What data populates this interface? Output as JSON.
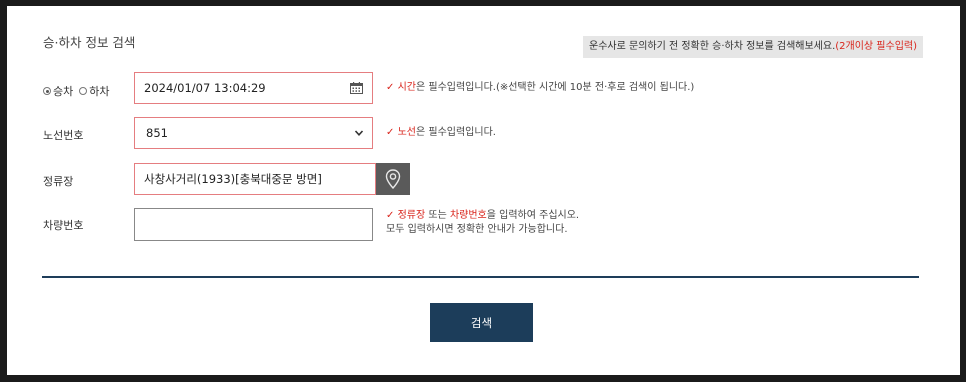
{
  "section": {
    "title": "승·하차 정보 검색",
    "notice_text": "운수사로 문의하기 전 정확한 승·하차 정보를 검색해보세요.",
    "notice_required": "(2개이상 필수입력)"
  },
  "time_row": {
    "radio_board": "승차",
    "radio_alight": "하차",
    "selected": "승차",
    "datetime_value": "2024/01/07 13:04:29",
    "hint_mark": "✓",
    "hint_key": "시간",
    "hint_rest": "은 필수입력입니다.(※선택한 시간에 10분 전·후로 검색이 됩니다.)"
  },
  "route_row": {
    "label": "노선번호",
    "selected_value": "851",
    "hint_mark": "✓",
    "hint_key": "노선",
    "hint_rest": "은 필수입력입니다."
  },
  "stop_row": {
    "label": "정류장",
    "value": "사창사거리(1933)[충북대중문 방면]"
  },
  "vehicle_row": {
    "label": "차량번호",
    "value": "",
    "hint_mark": "✓",
    "hint_key1": "정류장",
    "hint_mid": " 또는 ",
    "hint_key2": "차량번호",
    "hint_rest": "을 입력하여 주십시오.",
    "hint_line2": "모두 입력하시면 정확한 안내가 가능합니다."
  },
  "search_button": "검색",
  "colors": {
    "required_red": "#d9251c",
    "navy": "#1c3d5a",
    "field_border_red": "#e57d80"
  },
  "icons": {
    "calendar": "calendar-icon",
    "dropdown": "chevron-down-icon",
    "map": "map-pin-icon"
  }
}
